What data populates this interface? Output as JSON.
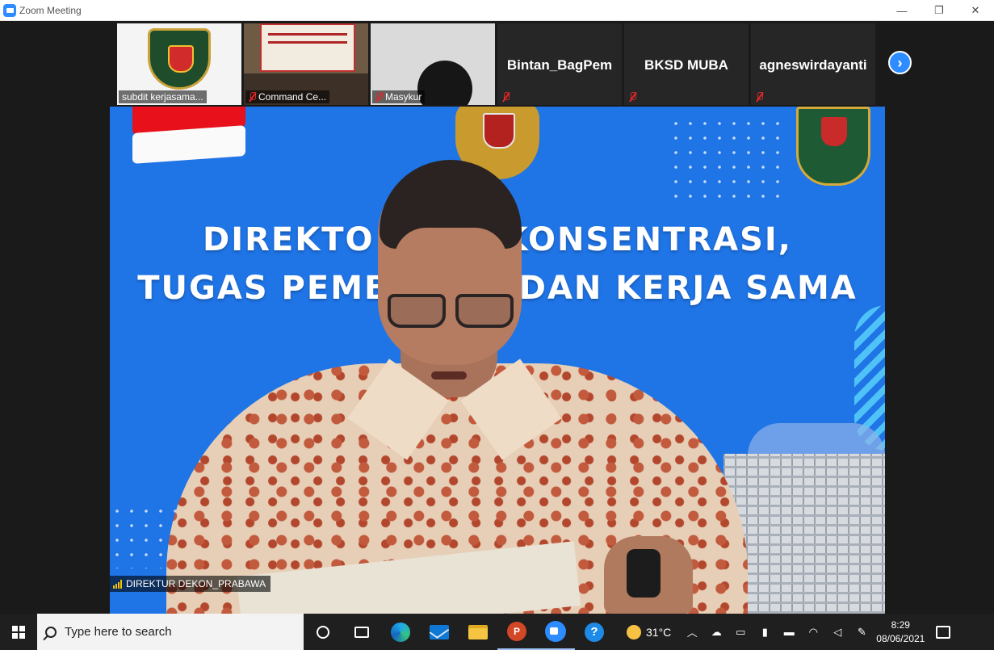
{
  "window": {
    "title": "Zoom Meeting",
    "controls": {
      "minimize": "—",
      "restore": "❐",
      "close": "✕"
    }
  },
  "participants": [
    {
      "name": "subdit kerjasama...",
      "video": "emblem",
      "muted": false
    },
    {
      "name": "Command Ce...",
      "video": "room",
      "muted": true
    },
    {
      "name": "Masykur",
      "video": "camera",
      "muted": true
    },
    {
      "name": "Bintan_BagPem",
      "video": "off",
      "muted": true
    },
    {
      "name": "BKSD MUBA",
      "video": "off",
      "muted": true
    },
    {
      "name": "agneswirdayanti",
      "video": "off",
      "muted": true
    }
  ],
  "next_page_icon": "chevron-right-icon",
  "speaker": {
    "name": "DIREKTUR DEKON_PRABAWA",
    "background_text_line1": "DIREKTO          KONSENTRASI,",
    "background_text_line2": "TUGAS PEMB          DAN KERJA SAMA"
  },
  "taskbar": {
    "search_placeholder": "Type here to search",
    "weather_temp": "31°C",
    "time": "8:29",
    "date": "08/06/2021",
    "pinned": [
      "cortana-icon",
      "task-view-icon",
      "edge-icon",
      "mail-icon",
      "file-explorer-icon",
      "powerpoint-icon",
      "zoom-icon",
      "help-icon"
    ],
    "ppt_letter": "P",
    "help_letter": "?"
  },
  "colors": {
    "zoom_blue": "#2d8cff",
    "video_bg": "#1f74e6",
    "muted_red": "#e02828"
  }
}
